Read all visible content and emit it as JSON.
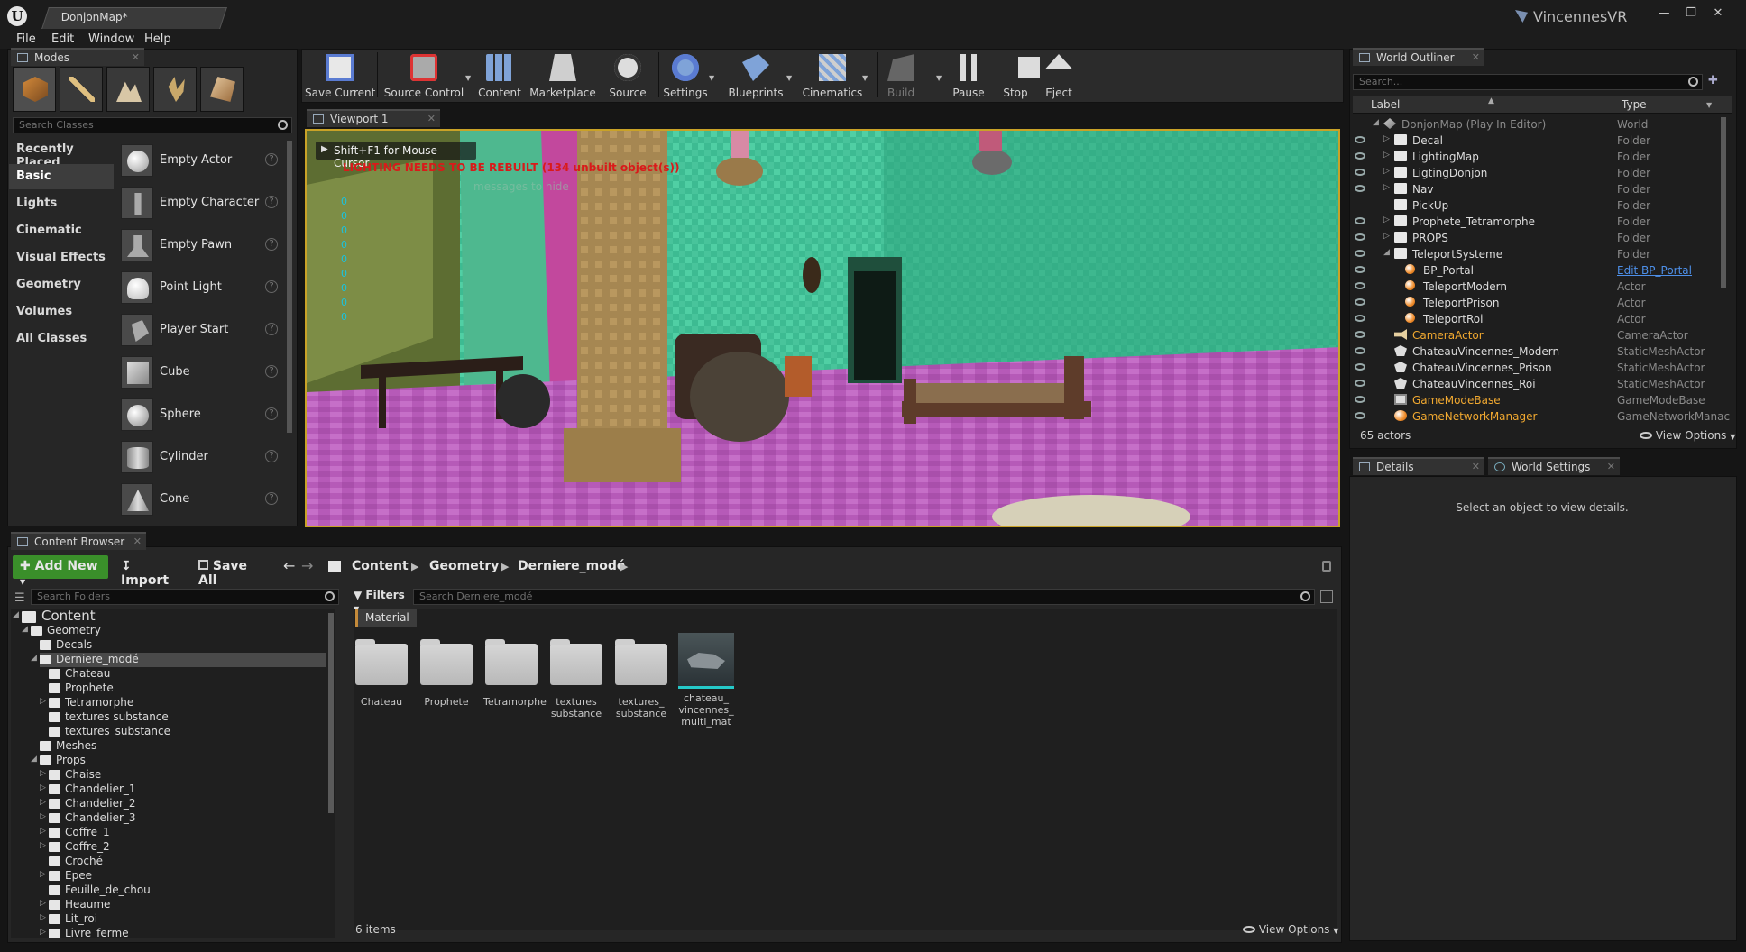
{
  "title_bar": {
    "document_tab": "DonjonMap*",
    "project_name": "VincennesVR",
    "window_buttons": [
      "minimize",
      "restore",
      "close"
    ]
  },
  "menu": [
    "File",
    "Edit",
    "Window",
    "Help"
  ],
  "modes_panel": {
    "tab_label": "Modes",
    "mode_icons": [
      "place-mode-icon",
      "paint-mode-icon",
      "landscape-mode-icon",
      "foliage-mode-icon",
      "geometry-mode-icon"
    ],
    "search_placeholder": "Search Classes",
    "categories": [
      "Recently Placed",
      "Basic",
      "Lights",
      "Cinematic",
      "Visual Effects",
      "Geometry",
      "Volumes",
      "All Classes"
    ],
    "active_category": "Basic",
    "items": [
      "Empty Actor",
      "Empty Character",
      "Empty Pawn",
      "Point Light",
      "Player Start",
      "Cube",
      "Sphere",
      "Cylinder",
      "Cone"
    ]
  },
  "toolbar": {
    "buttons": [
      {
        "label": "Save Current",
        "icon": "save-icon"
      },
      {
        "label": "Source Control",
        "icon": "source-control-icon"
      },
      {
        "label": "Content",
        "icon": "content-icon"
      },
      {
        "label": "Marketplace",
        "icon": "marketplace-icon"
      },
      {
        "label": "Source",
        "icon": "source-icon"
      },
      {
        "label": "Settings",
        "icon": "settings-icon"
      },
      {
        "label": "Blueprints",
        "icon": "blueprints-icon"
      },
      {
        "label": "Cinematics",
        "icon": "cinematics-icon"
      },
      {
        "label": "Build",
        "icon": "build-icon"
      },
      {
        "label": "Pause",
        "icon": "pause-icon"
      },
      {
        "label": "Stop",
        "icon": "stop-icon"
      },
      {
        "label": "Eject",
        "icon": "eject-icon"
      }
    ]
  },
  "viewport": {
    "tab_label": "Viewport 1",
    "hint": "Shift+F1 for Mouse Cursor",
    "warning": "LIGHTING NEEDS TO BE REBUILT (134 unbuilt object(s))",
    "faded_message": "messages to hide",
    "stat_zeros": [
      "0",
      "0",
      "0",
      "0",
      "0",
      "0",
      "0",
      "0",
      "0"
    ]
  },
  "world_outliner": {
    "tab_label": "World Outliner",
    "search_placeholder": "Search...",
    "columns": [
      "Label",
      "Type"
    ],
    "rows": [
      {
        "label": "DonjonMap (Play In Editor)",
        "type": "World",
        "kind": "world",
        "indent": 0,
        "arrow": "open",
        "dim": true
      },
      {
        "label": "Decal",
        "type": "Folder",
        "kind": "folder",
        "indent": 1,
        "arrow": "closed"
      },
      {
        "label": "LightingMap",
        "type": "Folder",
        "kind": "folder",
        "indent": 1,
        "arrow": "closed"
      },
      {
        "label": "LigtingDonjon",
        "type": "Folder",
        "kind": "folder",
        "indent": 1,
        "arrow": "closed"
      },
      {
        "label": "Nav",
        "type": "Folder",
        "kind": "folder",
        "indent": 1,
        "arrow": "closed"
      },
      {
        "label": "PickUp",
        "type": "Folder",
        "kind": "folder",
        "indent": 1,
        "arrow": "none"
      },
      {
        "label": "Prophete_Tetramorphe",
        "type": "Folder",
        "kind": "folder",
        "indent": 1,
        "arrow": "closed"
      },
      {
        "label": "PROPS",
        "type": "Folder",
        "kind": "folder",
        "indent": 1,
        "arrow": "closed"
      },
      {
        "label": "TeleportSysteme",
        "type": "Folder",
        "kind": "folder",
        "indent": 1,
        "arrow": "open"
      },
      {
        "label": "BP_Portal",
        "type": "Edit BP_Portal",
        "kind": "actor",
        "indent": 2,
        "arrow": "none",
        "link": true
      },
      {
        "label": "TeleportModern",
        "type": "Actor",
        "kind": "actor",
        "indent": 2,
        "arrow": "none"
      },
      {
        "label": "TeleportPrison",
        "type": "Actor",
        "kind": "actor",
        "indent": 2,
        "arrow": "none"
      },
      {
        "label": "TeleportRoi",
        "type": "Actor",
        "kind": "actor",
        "indent": 2,
        "arrow": "none"
      },
      {
        "label": "CameraActor",
        "type": "CameraActor",
        "kind": "camera",
        "indent": 1,
        "arrow": "none",
        "highlight": true
      },
      {
        "label": "ChateauVincennes_Modern",
        "type": "StaticMeshActor",
        "kind": "mesh",
        "indent": 1,
        "arrow": "none"
      },
      {
        "label": "ChateauVincennes_Prison",
        "type": "StaticMeshActor",
        "kind": "mesh",
        "indent": 1,
        "arrow": "none"
      },
      {
        "label": "ChateauVincennes_Roi",
        "type": "StaticMeshActor",
        "kind": "mesh",
        "indent": 1,
        "arrow": "none"
      },
      {
        "label": "GameModeBase",
        "type": "GameModeBase",
        "kind": "gamemode",
        "indent": 1,
        "arrow": "none",
        "highlight": true
      },
      {
        "label": "GameNetworkManager",
        "type": "GameNetworkManac",
        "kind": "network",
        "indent": 1,
        "arrow": "none",
        "highlight": true
      }
    ],
    "actor_count": "65 actors",
    "view_options": "View Options"
  },
  "details": {
    "tabs": [
      "Details",
      "World Settings"
    ],
    "empty_message": "Select an object to view details."
  },
  "content_browser": {
    "tab_label": "Content Browser",
    "add_new": "Add New",
    "import": "Import",
    "save_all": "Save All",
    "breadcrumb": [
      "Content",
      "Geometry",
      "Derniere_modé"
    ],
    "folder_search_placeholder": "Search Folders",
    "filters": "Filters",
    "asset_search_placeholder": "Search Derniere_modé",
    "filter_chip": "Material",
    "tree": [
      {
        "label": "Content",
        "depth": 0,
        "arrow": "open",
        "big": true
      },
      {
        "label": "Geometry",
        "depth": 1,
        "arrow": "open"
      },
      {
        "label": "Decals",
        "depth": 2,
        "arrow": "none"
      },
      {
        "label": "Derniere_modé",
        "depth": 2,
        "arrow": "open",
        "selected": true
      },
      {
        "label": "Chateau",
        "depth": 3,
        "arrow": "none"
      },
      {
        "label": "Prophete",
        "depth": 3,
        "arrow": "none"
      },
      {
        "label": "Tetramorphe",
        "depth": 3,
        "arrow": "closed"
      },
      {
        "label": "textures substance",
        "depth": 3,
        "arrow": "none"
      },
      {
        "label": "textures_substance",
        "depth": 3,
        "arrow": "none"
      },
      {
        "label": "Meshes",
        "depth": 2,
        "arrow": "none"
      },
      {
        "label": "Props",
        "depth": 2,
        "arrow": "open"
      },
      {
        "label": "Chaise",
        "depth": 3,
        "arrow": "closed"
      },
      {
        "label": "Chandelier_1",
        "depth": 3,
        "arrow": "closed"
      },
      {
        "label": "Chandelier_2",
        "depth": 3,
        "arrow": "closed"
      },
      {
        "label": "Chandelier_3",
        "depth": 3,
        "arrow": "closed"
      },
      {
        "label": "Coffre_1",
        "depth": 3,
        "arrow": "closed"
      },
      {
        "label": "Coffre_2",
        "depth": 3,
        "arrow": "closed"
      },
      {
        "label": "Croché",
        "depth": 3,
        "arrow": "none"
      },
      {
        "label": "Epee",
        "depth": 3,
        "arrow": "closed"
      },
      {
        "label": "Feuille_de_chou",
        "depth": 3,
        "arrow": "none"
      },
      {
        "label": "Heaume",
        "depth": 3,
        "arrow": "closed"
      },
      {
        "label": "Lit_roi",
        "depth": 3,
        "arrow": "closed"
      },
      {
        "label": "Livre_ferme",
        "depth": 3,
        "arrow": "closed"
      }
    ],
    "assets": [
      {
        "label": "Chateau",
        "kind": "folder"
      },
      {
        "label": "Prophete",
        "kind": "folder"
      },
      {
        "label": "Tetramorphe",
        "kind": "folder"
      },
      {
        "label": "textures substance",
        "kind": "folder"
      },
      {
        "label": "textures_ substance",
        "kind": "folder"
      },
      {
        "label": "chateau_ vincennes_ multi_mat",
        "kind": "mesh"
      }
    ],
    "item_count": "6 items",
    "view_options": "View Options"
  },
  "colors": {
    "accent_orange": "#c9a227",
    "add_new_green": "#3a8f2a",
    "outliner_highlight": "#f0a830",
    "link_blue": "#4d8fe8",
    "warning_red": "#d91a1a"
  }
}
